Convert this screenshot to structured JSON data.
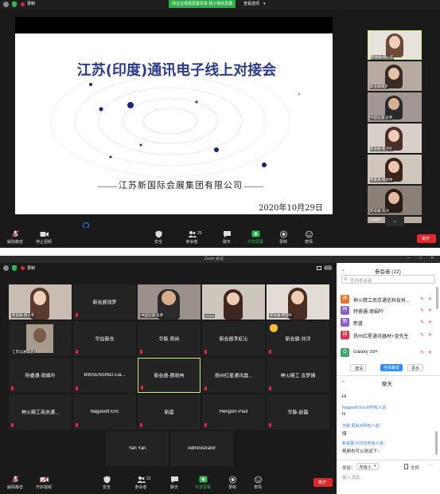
{
  "top": {
    "status": {
      "rec_label": "录制",
      "banner": "你正在观看屏幕共享 杨小菲的屏幕",
      "view_options": "查看选项"
    },
    "slide": {
      "title": "江苏(印度)通讯电子线上对接会",
      "org": "江苏新国际会展集团有限公司",
      "date": "2020年10月29日"
    },
    "gallery": [
      {
        "caption": "新会展-杨小菲"
      },
      {
        "caption": "新会展钱梦"
      },
      {
        "caption": "中国远通 张勇"
      },
      {
        "caption": "新会展-熊羽杉"
      },
      {
        "caption": "特睿通-揭婷婷"
      },
      {
        "caption": "新会展-刘洋"
      },
      {
        "caption": "1-8227"
      }
    ],
    "toolbar": {
      "unmute": "解除静音",
      "stop_video": "停止视频",
      "security": "安全",
      "participants": "参会者",
      "participants_count": "25",
      "chat": "聊天",
      "share": "共享屏幕",
      "record": "录制",
      "reactions": "表情",
      "leave": "离开"
    }
  },
  "bottom": {
    "window_title": "Zoom 会议",
    "status": {
      "rec_label": "录制",
      "view": "视图"
    },
    "tiles": [
      {
        "name": "",
        "caption": "新会展 杨小菲",
        "video": true
      },
      {
        "name": "新会展钱梦",
        "caption": "",
        "video": false
      },
      {
        "name": "",
        "caption": "中国远通 张勇",
        "video": true
      },
      {
        "name": "",
        "caption": "Orion",
        "video": true
      },
      {
        "name": "",
        "caption": "新会展-熊羽杉",
        "video": true
      },
      {
        "name": "",
        "caption": "江苏远通电话",
        "video": true
      },
      {
        "name": "华信献仓",
        "caption": "",
        "video": false
      },
      {
        "name": "华脉 周尚",
        "caption": "",
        "video": false
      },
      {
        "name": "新会展李虹沁",
        "caption": "",
        "video": false
      },
      {
        "name": "新会展-刘洋",
        "caption": "",
        "video": false
      },
      {
        "name": "特睿通-周娟吟",
        "caption": "",
        "video": false
      },
      {
        "name": "BWSENSING-Lia...",
        "caption": "",
        "video": false
      },
      {
        "name": "新会展-费晓冉",
        "caption": "",
        "video": false
      },
      {
        "name": "扬州红星通讯器...",
        "caption": "",
        "video": false
      },
      {
        "name": "神火精工 汝梦婧",
        "caption": "",
        "video": false
      },
      {
        "name": "神火精工南京通...",
        "caption": "",
        "video": false
      },
      {
        "name": "Nagasoft Eric",
        "caption": "",
        "video": false
      },
      {
        "name": "新盛",
        "caption": "",
        "video": false
      },
      {
        "name": "Hengxin Paul",
        "caption": "",
        "video": false
      },
      {
        "name": "华脉-赵磊",
        "caption": "",
        "video": false
      },
      {
        "name": "Yan Yan",
        "caption": "",
        "video": false
      },
      {
        "name": "Administrator",
        "caption": "",
        "video": false
      }
    ],
    "participants_panel": {
      "title": "参会者 (22)",
      "search_placeholder": "查找参会者",
      "list": [
        {
          "initial": "神",
          "name": "神火精工南京通信科技有...",
          "color": "#e8742d"
        },
        {
          "initial": "特",
          "name": "特睿通-周娟吟",
          "color": "#8b5fc7"
        },
        {
          "initial": "新",
          "name": "新盛",
          "color": "#8b5fc7"
        },
        {
          "initial": "扬",
          "name": "扬州红星通讯器材+金先生",
          "color": "#d6374e"
        },
        {
          "initial": "G",
          "name": "Galaxy S9+",
          "color": "#3da86b"
        }
      ],
      "invite": "邀请",
      "mute_all": "全体静音",
      "more": "更多"
    },
    "chat": {
      "title": "聊天",
      "messages": [
        {
          "from": "",
          "text": "Hi"
        },
        {
          "from": "Nagasoft Eric对所有人说：",
          "text": "hi"
        },
        {
          "from": "华脉 周尚对所有人说：",
          "text": "嗨"
        },
        {
          "from": "新会展-刘洋对所有人说：",
          "text": "视频也可以测试下~"
        }
      ],
      "to_label": "发给：",
      "to_value": "所有人",
      "file": "文件",
      "input_placeholder": "输入消息..."
    },
    "toolbar": {
      "unmute": "解除静音",
      "start_video": "开启视频",
      "security": "安全",
      "participants": "参会者",
      "participants_count": "22",
      "chat": "聊天",
      "share": "共享屏幕",
      "record": "录制",
      "reactions": "表情",
      "leave": "离开"
    }
  },
  "colors": {
    "leave": "#e0282e",
    "share_green": "#2db84d",
    "banner_green": "#2fae4a",
    "zoom_blue": "#2d8cff"
  }
}
